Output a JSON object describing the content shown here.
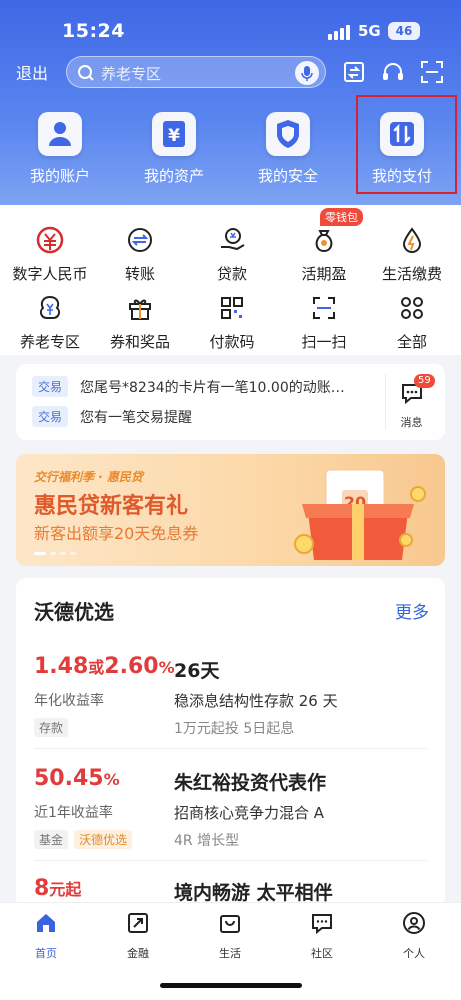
{
  "status": {
    "time": "15:24",
    "network": "5G",
    "battery": "46"
  },
  "topbar": {
    "exit_label": "退出",
    "search_placeholder": "养老专区"
  },
  "main_actions": [
    {
      "label": "我的账户",
      "icon": "user-icon"
    },
    {
      "label": "我的资产",
      "icon": "yuan-icon"
    },
    {
      "label": "我的安全",
      "icon": "shield-icon"
    },
    {
      "label": "我的支付",
      "icon": "transfer-arrows-icon"
    }
  ],
  "grid": {
    "badge": "零钱包",
    "items": [
      {
        "label": "数字人民币",
        "icon": "digital-rmb-icon"
      },
      {
        "label": "转账",
        "icon": "transfer-icon"
      },
      {
        "label": "贷款",
        "icon": "loan-icon"
      },
      {
        "label": "活期盈",
        "icon": "moneybag-icon"
      },
      {
        "label": "生活缴费",
        "icon": "utility-icon"
      },
      {
        "label": "养老专区",
        "icon": "pension-icon"
      },
      {
        "label": "券和奖品",
        "icon": "gift-icon"
      },
      {
        "label": "付款码",
        "icon": "qrcode-icon"
      },
      {
        "label": "扫一扫",
        "icon": "scan-icon"
      },
      {
        "label": "全部",
        "icon": "grid-all-icon"
      }
    ]
  },
  "notifications": {
    "items": [
      {
        "tag": "交易",
        "text": "您尾号*8234的卡片有一笔10.00的动账…"
      },
      {
        "tag": "交易",
        "text": "您有一笔交易提醒"
      }
    ],
    "message_label": "消息",
    "message_count": "59"
  },
  "banner": {
    "top": "交行福利季 · 惠民贷",
    "title": "惠民贷新客有礼",
    "subtitle": "新客出额享20天免息券",
    "coupon_value": "20"
  },
  "picks": {
    "title": "沃德优选",
    "more": "更多",
    "items": [
      {
        "rate_a": "1.48",
        "rate_or": "或",
        "rate_b": "2.60",
        "rate_unit": "%",
        "rate_label": "年化收益率",
        "tags": [
          "存款"
        ],
        "name": "26天",
        "desc": "稳添息结构性存款 26 天",
        "meta": "1万元起投  5日起息"
      },
      {
        "rate_a": "50.45",
        "rate_unit": "%",
        "rate_label": "近1年收益率",
        "tags": [
          "基金",
          "沃德优选"
        ],
        "name": "朱红裕投资代表作",
        "desc": "招商核心竞争力混合 A",
        "meta": "4R 增长型"
      },
      {
        "rate_a": "8",
        "rate_unit": "元起",
        "name": "境内畅游 太平相伴"
      }
    ]
  },
  "tabbar": [
    {
      "label": "首页",
      "icon": "home-icon",
      "active": true
    },
    {
      "label": "金融",
      "icon": "finance-icon"
    },
    {
      "label": "生活",
      "icon": "life-bag-icon"
    },
    {
      "label": "社区",
      "icon": "community-chat-icon"
    },
    {
      "label": "个人",
      "icon": "profile-icon"
    }
  ],
  "colors": {
    "brand_blue": "#3f67e6",
    "accent_red": "#e23b3b",
    "highlight_red": "#d6212f"
  }
}
